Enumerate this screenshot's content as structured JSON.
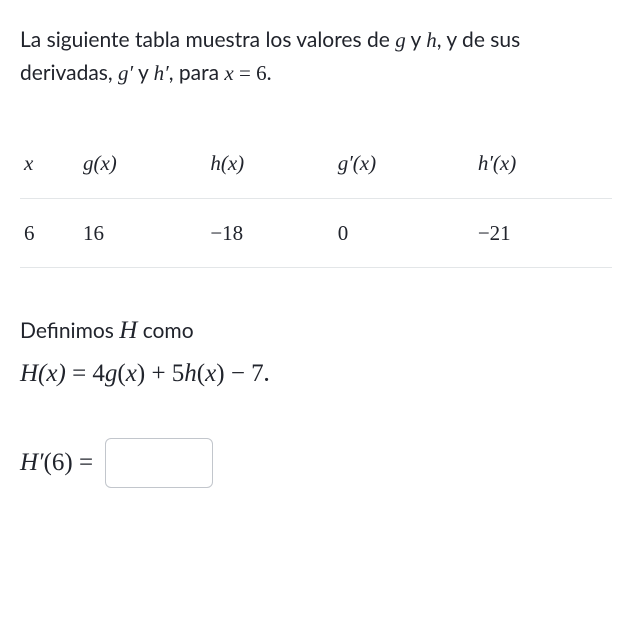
{
  "intro": {
    "part1": "La siguiente tabla muestra los valores de ",
    "g": "g",
    "and1": " y ",
    "h": "h",
    "part2": ", y de sus derivadas, ",
    "gp": "g′",
    "and2": " y ",
    "hp": "h′",
    "part3": ", para ",
    "eq_x": "x",
    "eq_eq": " = ",
    "eq_val": "6",
    "period": "."
  },
  "table": {
    "headers": {
      "x": "x",
      "gx": "g(x)",
      "hx": "h(x)",
      "gpx": "g′(x)",
      "hpx": "h′(x)"
    },
    "row": {
      "x": "6",
      "gx": "16",
      "hx": "−18",
      "gpx": "0",
      "hpx": "−21"
    }
  },
  "def": {
    "lead": "Definimos ",
    "H": "H",
    "as": " como",
    "Hx": "H(x)",
    "eq": " = ",
    "coef1": "4",
    "g": "g",
    "lp1": "(",
    "x1": "x",
    "rp1": ")",
    "plus": " + ",
    "coef2": "5",
    "h": "h",
    "lp2": "(",
    "x2": "x",
    "rp2": ")",
    "minus": " − ",
    "const": "7",
    "period": "."
  },
  "answer": {
    "Hprime": "H′",
    "lp": "(",
    "arg": "6",
    "rp": ")",
    "eq": " = "
  },
  "chart_data": {
    "type": "table",
    "columns": [
      "x",
      "g(x)",
      "h(x)",
      "g'(x)",
      "h'(x)"
    ],
    "rows": [
      [
        6,
        16,
        -18,
        0,
        -21
      ]
    ]
  }
}
